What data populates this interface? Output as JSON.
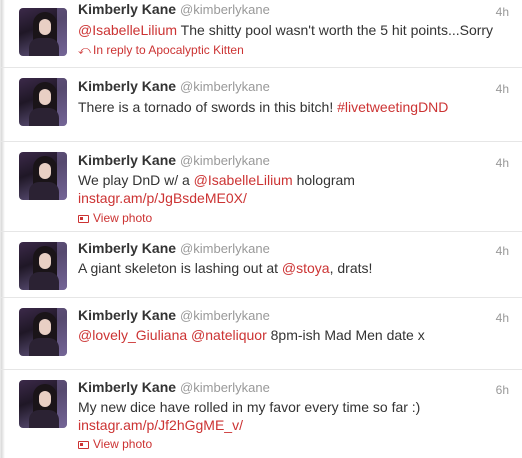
{
  "tweets": [
    {
      "name": "Kimberly Kane",
      "handle": "@kimberlykane",
      "time": "4h",
      "mention": "@IsabelleLilium",
      "text": " The shitty pool wasn't worth the 5 hit points...Sorry",
      "reply": "In reply to Apocalyptic Kitten"
    },
    {
      "name": "Kimberly Kane",
      "handle": "@kimberlykane",
      "time": "4h",
      "text": "There is a tornado of swords in this bitch! ",
      "hashtag": "#livetweetingDND"
    },
    {
      "name": "Kimberly Kane",
      "handle": "@kimberlykane",
      "time": "4h",
      "text_pre": "We play DnD w/ a ",
      "mention": "@IsabelleLilium",
      "text_post": " hologram",
      "link": "instagr.am/p/JgBsdeME0X/",
      "view_photo": "View photo"
    },
    {
      "name": "Kimberly Kane",
      "handle": "@kimberlykane",
      "time": "4h",
      "text_pre": "A giant skeleton is lashing out at ",
      "mention": "@stoya",
      "text_post": ", drats!"
    },
    {
      "name": "Kimberly Kane",
      "handle": "@kimberlykane",
      "time": "4h",
      "mention1": "@lovely_Giuliana",
      "mention2": "@nateliquor",
      "text": " 8pm-ish Mad Men date x"
    },
    {
      "name": "Kimberly Kane",
      "handle": "@kimberlykane",
      "time": "6h",
      "text": "My new dice have rolled in my favor every time so far :)",
      "link": "instagr.am/p/Jf2hGgME_v/",
      "view_photo": "View photo"
    }
  ],
  "icons": {
    "reply": "reply-arrow-icon",
    "photo": "photo-icon",
    "avatar": "avatar"
  },
  "colors": {
    "accent": "#cc3333",
    "meta": "#999999",
    "text": "#333333"
  }
}
